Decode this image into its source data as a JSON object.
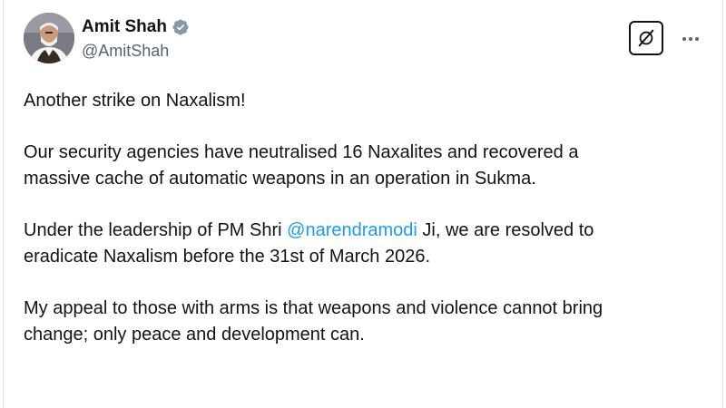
{
  "tweet": {
    "author": {
      "display_name": "Amit Shah",
      "handle": "@AmitShah",
      "verified": true,
      "verified_color": "#829aab"
    },
    "icons": {
      "grok": "grok-icon",
      "more": "more-options-icon",
      "verified": "verified-badge-icon"
    },
    "paragraphs": [
      {
        "line1": "Another strike on Naxalism!"
      },
      {
        "line1": "Our security agencies have neutralised 16 Naxalites and recovered a",
        "line2": "massive cache of automatic weapons in an operation in Sukma."
      },
      {
        "line1_pre": "Under the leadership of PM Shri ",
        "mention": "@narendramodi",
        "line1_post": " Ji, we are resolved to",
        "line2": "eradicate Naxalism before the 31st of March 2026."
      },
      {
        "line1": "My appeal to those with arms is that weapons and violence cannot bring",
        "line2": "change; only peace and development can."
      }
    ],
    "link_color": "#1d9bf0"
  }
}
